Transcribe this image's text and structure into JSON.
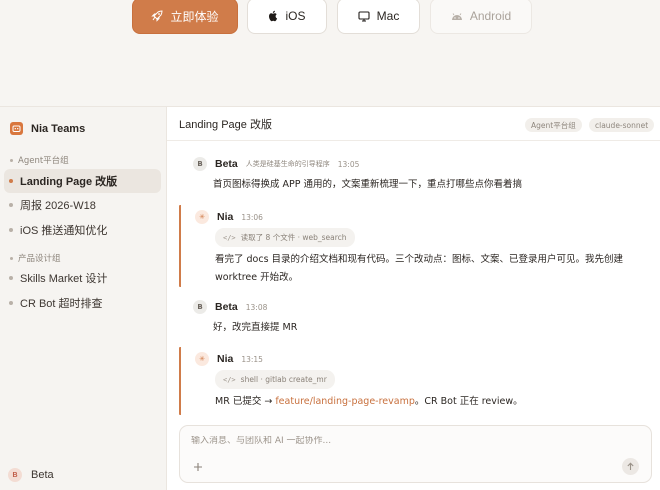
{
  "downloads": {
    "primary_label": "立即体验",
    "ios_label": "iOS",
    "mac_label": "Mac",
    "android_label": "Android"
  },
  "sidebar": {
    "team_name": "Nia Teams",
    "groups": [
      {
        "label": "Agent平台组",
        "items": [
          "Landing Page 改版",
          "周报 2026-W18",
          "iOS 推送通知优化"
        ]
      },
      {
        "label": "产品设计组",
        "items": [
          "Skills Market 设计",
          "CR Bot 超时排查"
        ]
      }
    ],
    "active_item": "Landing Page 改版",
    "user": {
      "initial": "B",
      "name": "Beta"
    }
  },
  "channel": {
    "title": "Landing Page 改版",
    "tags": [
      "Agent平台组",
      "claude-sonnet"
    ]
  },
  "messages": [
    {
      "sender": "Beta",
      "initial": "B",
      "type": "user",
      "role_note": "人类是硅基生命的引导程序",
      "time": "13:05",
      "text": "首页图标得换成 APP 通用的，文案重新梳理一下，重点打哪些点你看着搞"
    },
    {
      "sender": "Nia",
      "initial": "✳",
      "type": "ai",
      "time": "13:06",
      "tool": "读取了 8 个文件 · web_search",
      "text": "看完了 docs 目录的介绍文档和现有代码。三个改动点：图标、文案、已登录用户可见。我先创建 worktree 开始改。"
    },
    {
      "sender": "Beta",
      "initial": "B",
      "type": "user",
      "time": "13:08",
      "text": "好，改完直接提 MR"
    },
    {
      "sender": "Nia",
      "initial": "✳",
      "type": "ai",
      "time": "13:15",
      "tool": "shell · gitlab create_mr",
      "text_before": "MR 已提交 → ",
      "link": "feature/landing-page-revamp",
      "text_after": "。CR Bot 正在 review。"
    }
  ],
  "composer": {
    "placeholder": "输入消息、与团队和 AI 一起协作..."
  },
  "colors": {
    "accent": "#d07c4a",
    "sidebar_bg": "#f6f4f1",
    "active_item_bg": "#ebe6e0"
  }
}
